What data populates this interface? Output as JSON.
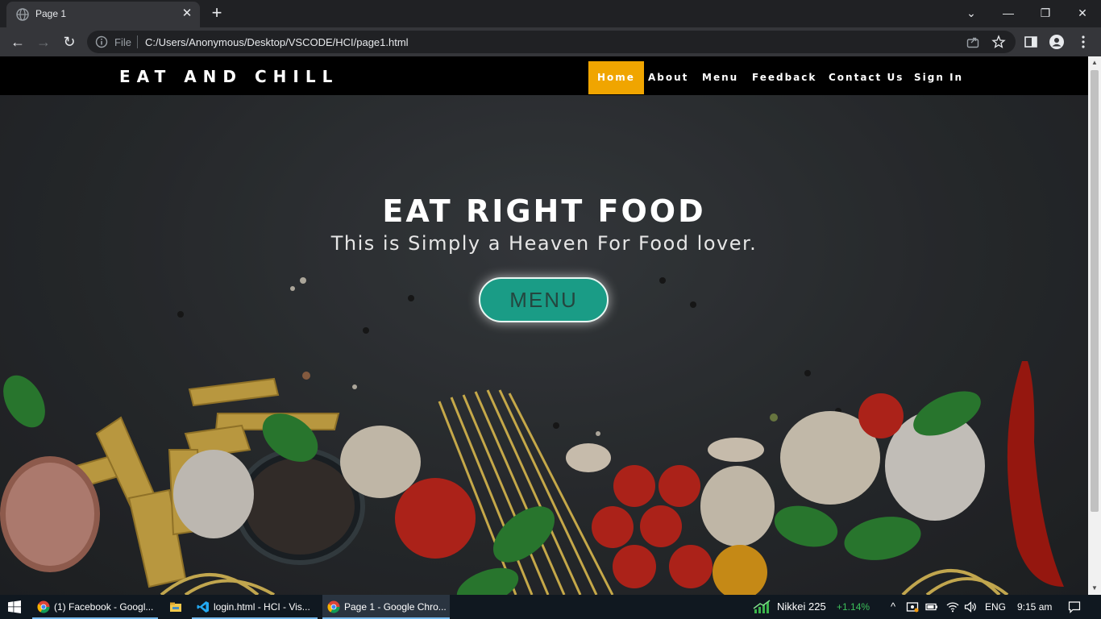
{
  "browser": {
    "tab": {
      "title": "Page 1",
      "close": "✕"
    },
    "new_tab": "+",
    "window": {
      "dropdown": "⌄",
      "minimize": "—",
      "restore": "❐",
      "close": "✕"
    },
    "nav": {
      "back": "←",
      "forward": "→",
      "reload": "↻"
    },
    "address": {
      "scheme": "File",
      "url": "C:/Users/Anonymous/Desktop/VSCODE/HCI/page1.html"
    }
  },
  "site": {
    "logo": "EAT AND CHILL",
    "menu": [
      {
        "label": "Home",
        "active": true
      },
      {
        "label": "About"
      },
      {
        "label": "Menu"
      },
      {
        "label": "Feedback"
      },
      {
        "label": "Contact Us"
      },
      {
        "label": "Sign In"
      }
    ],
    "hero": {
      "title": "EAT RIGHT FOOD",
      "subtitle": "This is Simply a Heaven For Food lover.",
      "button": "MENU"
    },
    "accent_color": "#f0a500",
    "button_color": "#1a9c86"
  },
  "taskbar": {
    "items": [
      {
        "label": "(1) Facebook - Googl...",
        "icon": "chrome-icon"
      },
      {
        "label": "",
        "icon": "file-explorer-icon"
      },
      {
        "label": "login.html - HCI - Vis...",
        "icon": "vscode-icon"
      },
      {
        "label": "Page 1 - Google Chro...",
        "icon": "chrome-icon",
        "active": true
      }
    ],
    "stock": {
      "name": "Nikkei 225",
      "change": "+1.14%"
    },
    "language": "ENG",
    "time": "9:15 am"
  }
}
